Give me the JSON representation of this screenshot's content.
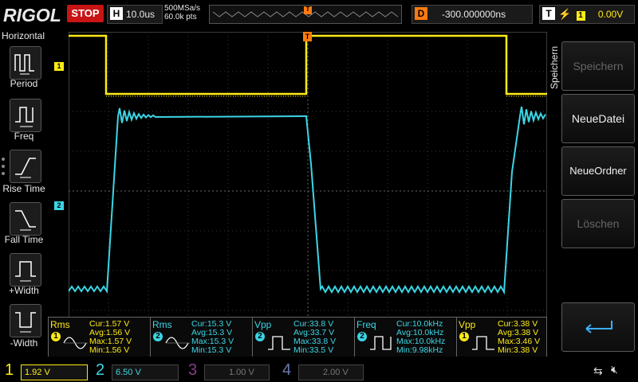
{
  "header": {
    "brand": "RIGOL",
    "run_state": "STOP",
    "timebase_label": "H",
    "timebase_value": "10.0us",
    "sample_rate": "500MSa/s",
    "memory_depth": "60.0k pts",
    "delay_label": "D",
    "delay_value": "-300.000000ns",
    "trigger_label": "T",
    "trigger_channel": "1",
    "trigger_level": "0.00V",
    "trigger_marker": "T"
  },
  "left_panel": {
    "title": "Horizontal",
    "items": [
      {
        "label": "Period",
        "icon": "period-icon"
      },
      {
        "label": "Freq",
        "icon": "frequency-icon"
      },
      {
        "label": "Rise Time",
        "icon": "rise-time-icon"
      },
      {
        "label": "Fall Time",
        "icon": "fall-time-icon"
      },
      {
        "label": "+Width",
        "icon": "positive-width-icon"
      },
      {
        "label": "-Width",
        "icon": "negative-width-icon"
      }
    ]
  },
  "right_panel": {
    "title": "Speichern",
    "buttons": [
      {
        "label": "Speichern",
        "enabled": false
      },
      {
        "label": "NeueDatei",
        "enabled": true
      },
      {
        "label": "NeueOrdner",
        "enabled": true
      },
      {
        "label": "Löschen",
        "enabled": false
      },
      {
        "label": "",
        "icon": "return-arrow-icon",
        "enabled": true
      }
    ]
  },
  "channel_markers": {
    "ch1": "1",
    "ch2": "2"
  },
  "measurements": [
    {
      "name": "Rms",
      "channel": "1",
      "cur": "Cur:1.57 V",
      "avg": "Avg:1.56 V",
      "max": "Max:1.57 V",
      "min": "Min:1.56 V"
    },
    {
      "name": "Rms",
      "channel": "2",
      "cur": "Cur:15.3 V",
      "avg": "Avg:15.3 V",
      "max": "Max:15.3 V",
      "min": "Min:15.3 V"
    },
    {
      "name": "Vpp",
      "channel": "2",
      "cur": "Cur:33.8 V",
      "avg": "Avg:33.7 V",
      "max": "Max:33.8 V",
      "min": "Min:33.5 V"
    },
    {
      "name": "Freq",
      "channel": "2",
      "cur": "Cur:10.0kHz",
      "avg": "Avg:10.0kHz",
      "max": "Max:10.0kHz",
      "min": "Min:9.98kHz"
    },
    {
      "name": "Vpp",
      "channel": "1",
      "cur": "Cur:3.38 V",
      "avg": "Avg:3.38 V",
      "max": "Max:3.46 V",
      "min": "Min:3.38 V"
    }
  ],
  "channels": [
    {
      "number": "1",
      "scale": "1.92 V",
      "active": true,
      "color": "#ffeb14"
    },
    {
      "number": "2",
      "scale": "6.50 V",
      "active": true,
      "color": "#3cd6e6"
    },
    {
      "number": "3",
      "scale": "1.00 V",
      "active": false,
      "color": "#c040c0"
    },
    {
      "number": "4",
      "scale": "2.00 V",
      "active": false,
      "color": "#4060ff"
    }
  ],
  "colors": {
    "ch1": "#ffeb14",
    "ch2": "#3cd6e6",
    "stop": "#c81414",
    "grid": "#3a3a3a"
  }
}
